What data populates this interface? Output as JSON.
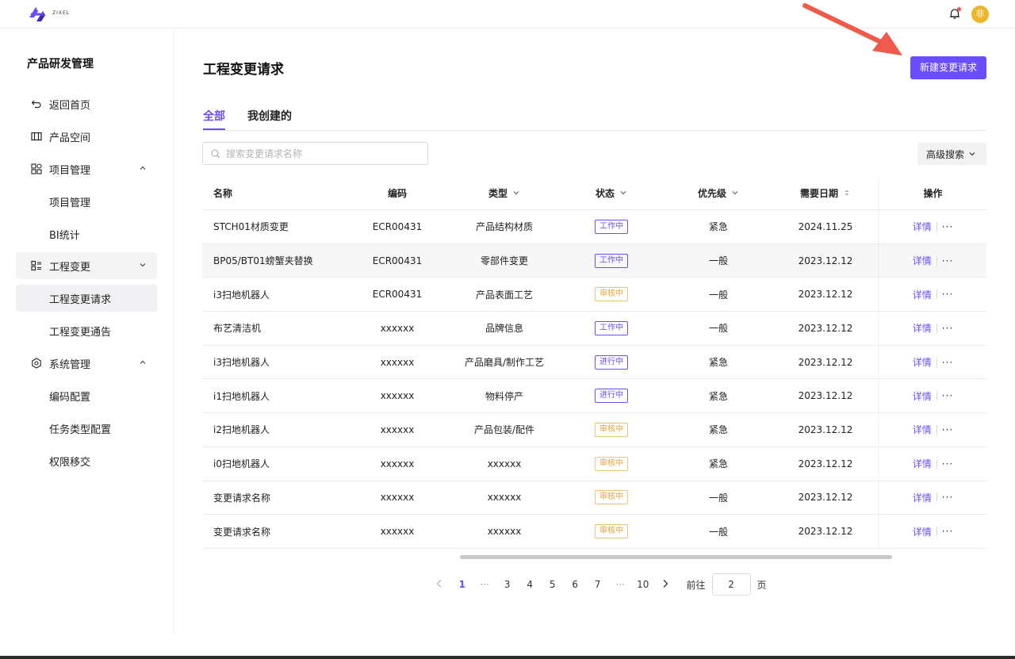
{
  "app": {
    "logo_text": "ZIXEL",
    "avatar_text": "非",
    "brand_color": "#6b4dff"
  },
  "sidebar": {
    "title": "产品研发管理",
    "items": [
      {
        "label": "返回首页",
        "icon": "back-icon"
      },
      {
        "label": "产品空间",
        "icon": "columns-icon"
      },
      {
        "label": "项目管理",
        "icon": "grid-icon",
        "expanded": true
      },
      {
        "label": "项目管理",
        "sub": true
      },
      {
        "label": "BI统计",
        "sub": true
      },
      {
        "label": "工程变更",
        "icon": "list-icon",
        "expanded": false
      },
      {
        "label": "工程变更请求",
        "sub": true,
        "active": true
      },
      {
        "label": "工程变更通告",
        "sub": true
      },
      {
        "label": "系统管理",
        "icon": "gear-icon",
        "expanded": true
      },
      {
        "label": "编码配置",
        "sub": true
      },
      {
        "label": "任务类型配置",
        "sub": true
      },
      {
        "label": "权限移交",
        "sub": true
      }
    ]
  },
  "main": {
    "title": "工程变更请求",
    "new_button": "新建变更请求",
    "tabs": [
      {
        "label": "全部",
        "active": true
      },
      {
        "label": "我创建的",
        "active": false
      }
    ],
    "search": {
      "placeholder": "搜索变更请求名称",
      "value": ""
    },
    "advanced_search": "高级搜索"
  },
  "table": {
    "columns": [
      "名称",
      "编码",
      "类型",
      "状态",
      "优先级",
      "需要日期",
      "操作"
    ],
    "rows": [
      {
        "name": "STCH01材质变更",
        "code": "ECR00431",
        "type": "产品结构材质",
        "status": "工作中",
        "status_kind": "working",
        "priority": "紧急",
        "date": "2024.11.25"
      },
      {
        "name": "BP05/BT01螃蟹夹替换",
        "code": "ECR00431",
        "type": "零部件变更",
        "status": "工作中",
        "status_kind": "working",
        "priority": "一般",
        "date": "2023.12.12"
      },
      {
        "name": "i3扫地机器人",
        "code": "ECR00431",
        "type": "产品表面工艺",
        "status": "审核中",
        "status_kind": "review",
        "priority": "一般",
        "date": "2023.12.12"
      },
      {
        "name": "布艺清洁机",
        "code": "xxxxxx",
        "type": "品牌信息",
        "status": "工作中",
        "status_kind": "working",
        "priority": "一般",
        "date": "2023.12.12"
      },
      {
        "name": "i3扫地机器人",
        "code": "xxxxxx",
        "type": "产品磨具/制作工艺",
        "status": "进行中",
        "status_kind": "working",
        "priority": "紧急",
        "date": "2023.12.12"
      },
      {
        "name": "i1扫地机器人",
        "code": "xxxxxx",
        "type": "物料停产",
        "status": "进行中",
        "status_kind": "working",
        "priority": "紧急",
        "date": "2023.12.12"
      },
      {
        "name": "i2扫地机器人",
        "code": "xxxxxx",
        "type": "产品包装/配件",
        "status": "审核中",
        "status_kind": "review",
        "priority": "紧急",
        "date": "2023.12.12"
      },
      {
        "name": "i0扫地机器人",
        "code": "xxxxxx",
        "type": "xxxxxx",
        "status": "审核中",
        "status_kind": "review",
        "priority": "紧急",
        "date": "2023.12.12"
      },
      {
        "name": "变更请求名称",
        "code": "xxxxxx",
        "type": "xxxxxx",
        "status": "审核中",
        "status_kind": "review",
        "priority": "一般",
        "date": "2023.12.12"
      },
      {
        "name": "变更请求名称",
        "code": "xxxxxx",
        "type": "xxxxxx",
        "status": "审核中",
        "status_kind": "review",
        "priority": "一般",
        "date": "2023.12.12"
      }
    ],
    "detail_label": "详情",
    "more_label": "···"
  },
  "pagination": {
    "pages": [
      "1",
      "···",
      "3",
      "4",
      "5",
      "6",
      "7",
      "···",
      "10"
    ],
    "current": "1",
    "goto_label": "前往",
    "goto_value": "2",
    "page_suffix": "页"
  },
  "colors": {
    "working": "#6b4dff",
    "review": "#e6a23c",
    "annotation_arrow": "#f05a4a"
  }
}
